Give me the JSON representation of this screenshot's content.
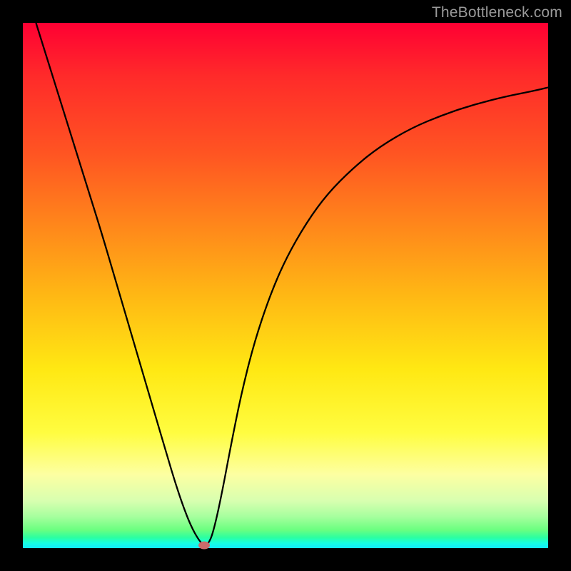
{
  "watermark": {
    "text": "TheBottleneck.com"
  },
  "gradient": {
    "stops": [
      {
        "pos": 0,
        "color": "#ff0033"
      },
      {
        "pos": 0.1,
        "color": "#ff2a2a"
      },
      {
        "pos": 0.25,
        "color": "#ff5522"
      },
      {
        "pos": 0.4,
        "color": "#ff8c1a"
      },
      {
        "pos": 0.52,
        "color": "#ffb814"
      },
      {
        "pos": 0.66,
        "color": "#ffe813"
      },
      {
        "pos": 0.78,
        "color": "#fffd40"
      },
      {
        "pos": 0.86,
        "color": "#fdffa2"
      },
      {
        "pos": 0.91,
        "color": "#d8ffb0"
      },
      {
        "pos": 0.94,
        "color": "#a6ff9e"
      },
      {
        "pos": 0.965,
        "color": "#6bff80"
      },
      {
        "pos": 0.98,
        "color": "#2bffa2"
      },
      {
        "pos": 0.99,
        "color": "#17ffe0"
      },
      {
        "pos": 1.0,
        "color": "#12e9ff"
      }
    ]
  },
  "chart_data": {
    "type": "line",
    "title": "",
    "xlabel": "",
    "ylabel": "",
    "xlim": [
      0,
      1
    ],
    "ylim": [
      0,
      1
    ],
    "grid": false,
    "series": [
      {
        "name": "bottleneck-curve",
        "x": [
          0.025,
          0.05,
          0.075,
          0.1,
          0.125,
          0.15,
          0.175,
          0.2,
          0.225,
          0.25,
          0.275,
          0.29,
          0.305,
          0.32,
          0.335,
          0.345,
          0.355,
          0.365,
          0.38,
          0.395,
          0.415,
          0.44,
          0.47,
          0.5,
          0.54,
          0.58,
          0.63,
          0.68,
          0.74,
          0.8,
          0.86,
          0.92,
          0.97,
          1.0
        ],
        "y": [
          1.0,
          0.92,
          0.84,
          0.76,
          0.68,
          0.6,
          0.515,
          0.43,
          0.345,
          0.26,
          0.175,
          0.125,
          0.08,
          0.042,
          0.015,
          0.005,
          0.01,
          0.04,
          0.11,
          0.19,
          0.29,
          0.39,
          0.48,
          0.55,
          0.62,
          0.675,
          0.725,
          0.765,
          0.8,
          0.825,
          0.845,
          0.86,
          0.87,
          0.877
        ]
      }
    ],
    "marker": {
      "x": 0.345,
      "y": 0.005,
      "color": "#cc6b6b"
    }
  }
}
